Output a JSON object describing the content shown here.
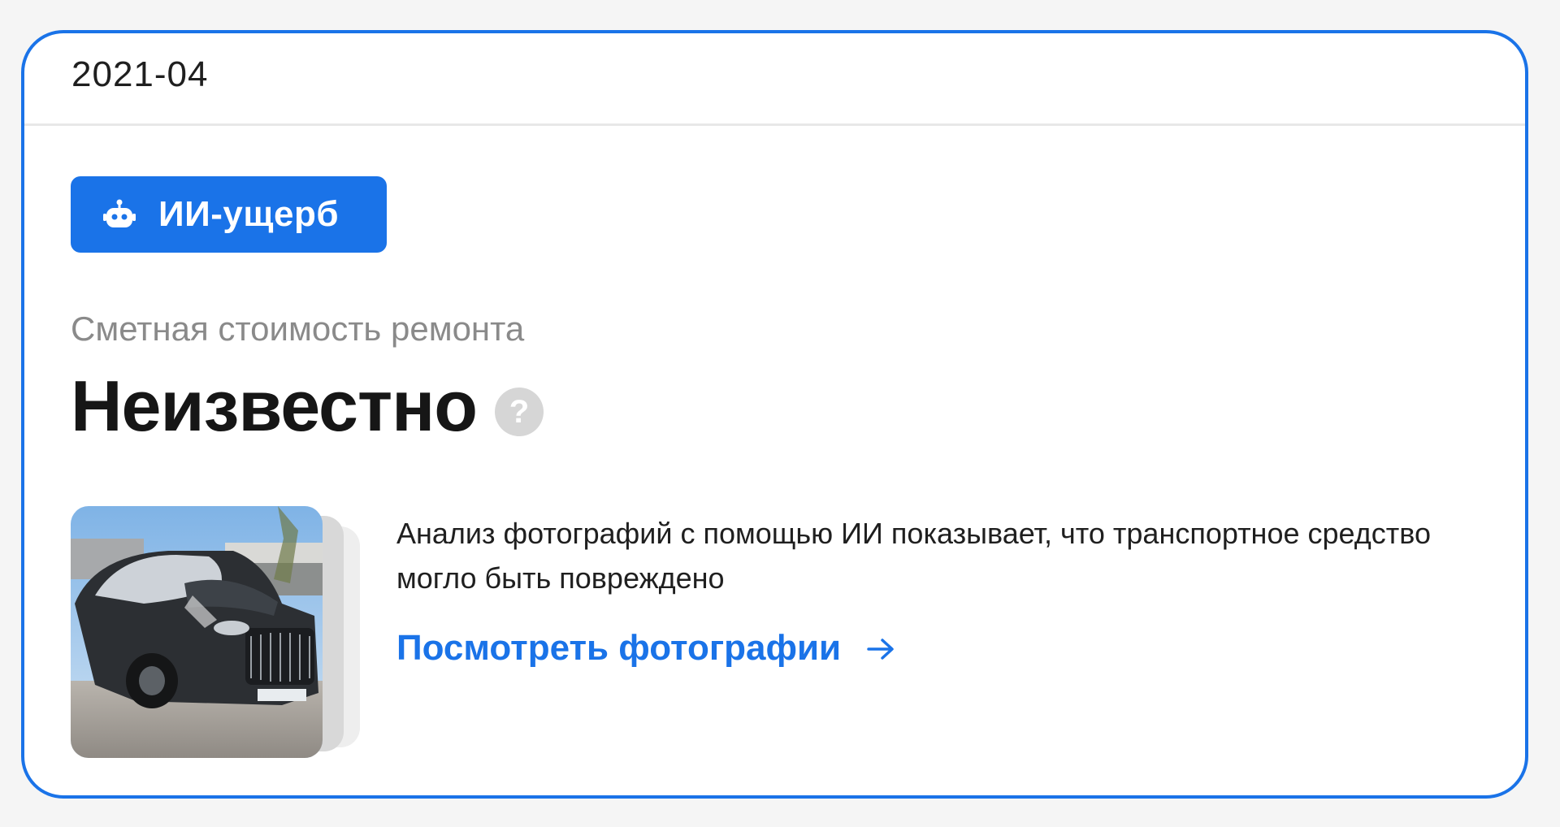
{
  "card": {
    "date": "2021-04",
    "badge": {
      "label": "ИИ-ущерб",
      "icon": "robot-icon"
    },
    "cost_label": "Сметная стоимость ремонта",
    "cost_value": "Неизвестно",
    "help_icon": "?",
    "description": "Анализ фотографий с помощью ИИ показывает, что транспортное средство могло быть повреждено",
    "link": {
      "label": "Посмотреть фотографии",
      "icon": "arrow-right-icon"
    }
  },
  "colors": {
    "accent": "#1a73e8",
    "muted_text": "#8a8a8a",
    "help_icon_bg": "#d6d6d6"
  }
}
